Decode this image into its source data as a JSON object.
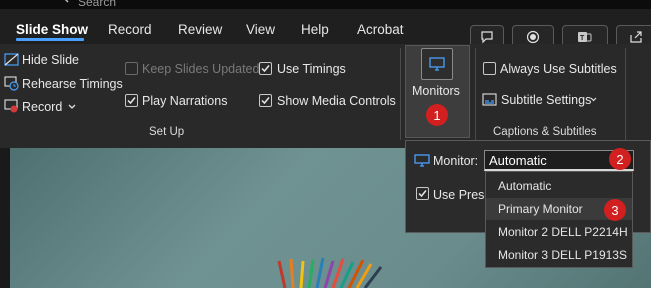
{
  "search_fragment": "Search",
  "tabs": [
    {
      "label": "Slide Show",
      "active": true
    },
    {
      "label": "Record",
      "active": false
    },
    {
      "label": "Review",
      "active": false
    },
    {
      "label": "View",
      "active": false
    },
    {
      "label": "Help",
      "active": false
    },
    {
      "label": "Acrobat",
      "active": false
    }
  ],
  "tab_buttons": [
    "comment-icon",
    "record-icon",
    "teams-icon",
    "share-icon"
  ],
  "ribbon": {
    "setup": {
      "hide_slide": "Hide Slide",
      "rehearse_timings": "Rehearse Timings",
      "record": "Record",
      "keep_slides_updated": {
        "label": "Keep Slides Updated",
        "checked": false,
        "enabled": false
      },
      "play_narrations": {
        "label": "Play Narrations",
        "checked": true
      },
      "use_timings": {
        "label": "Use Timings",
        "checked": true
      },
      "show_media_controls": {
        "label": "Show Media Controls",
        "checked": true
      },
      "group_label": "Set Up"
    },
    "monitors": {
      "label": "Monitors"
    },
    "captions": {
      "always_use_subtitles": {
        "label": "Always Use Subtitles",
        "checked": false
      },
      "subtitle_settings": "Subtitle Settings",
      "group_label": "Captions & Subtitles"
    }
  },
  "flyout": {
    "monitor_label": "Monitor:",
    "selected": "Automatic",
    "use_presenter_fragment": "Use Prese",
    "use_presenter_checked": true
  },
  "dropdown_options": [
    "Automatic",
    "Primary Monitor",
    "Monitor 2 DELL P2214H",
    "Monitor 3 DELL P1913S"
  ],
  "highlighted_option_index": 1,
  "badges": [
    "1",
    "2",
    "3"
  ],
  "colors": {
    "accent": "#4aa0ff",
    "badge": "#d21f1f"
  }
}
